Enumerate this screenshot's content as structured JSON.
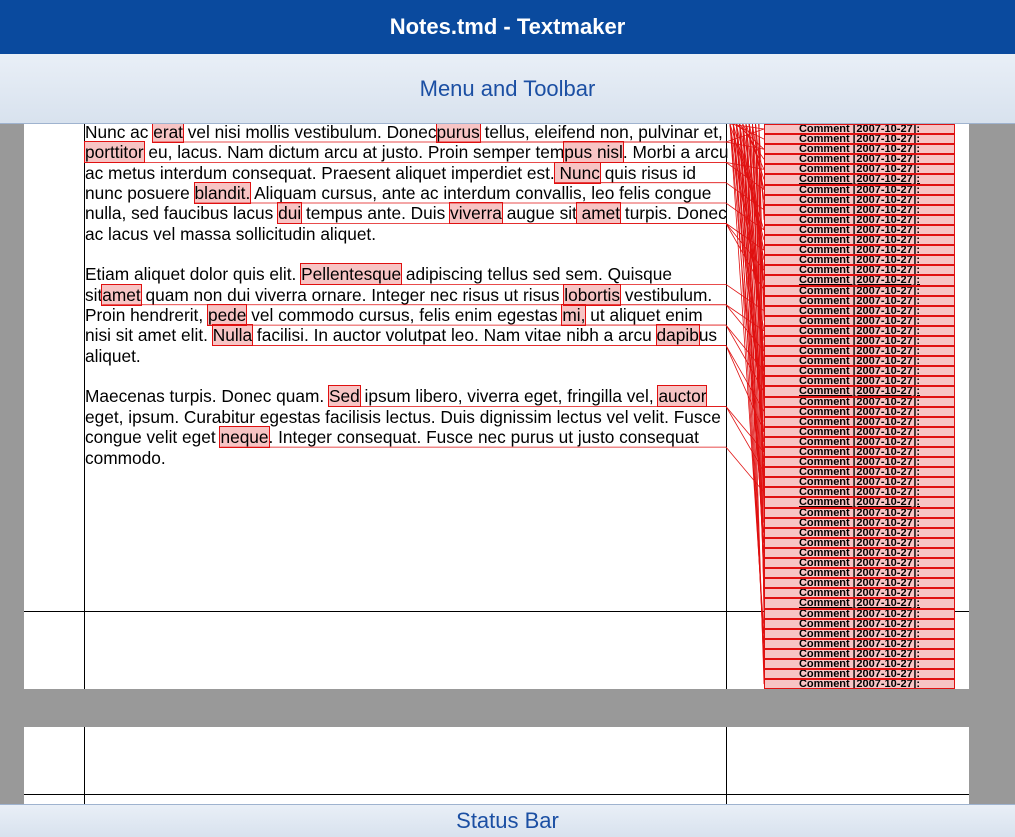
{
  "window": {
    "title": "Notes.tmd - Textmaker"
  },
  "toolbar": {
    "label": "Menu and Toolbar"
  },
  "statusbar": {
    "label": "Status Bar"
  },
  "document": {
    "paragraphs": [
      [
        {
          "t": "Nunc ac "
        },
        {
          "t": "erat",
          "c": 1
        },
        {
          "t": " vel nisi mollis vestibulum. Donec"
        },
        {
          "t": "purus",
          "c": 1
        },
        {
          "t": " tellus, eleifend non, pulvinar et, "
        },
        {
          "t": "porttitor",
          "c": 1
        },
        {
          "t": " eu, lacus. Nam dictum arcu at justo. Proin semper tem"
        },
        {
          "t": "pus nisl",
          "c": 1
        },
        {
          "t": ". Morbi a arcu ac metus interdum consequat. Praesent aliquet imperdiet est."
        },
        {
          "t": " Nunc",
          "c": 1
        },
        {
          "t": " quis risus id nunc posuere "
        },
        {
          "t": "blandit.",
          "c": 1
        },
        {
          "t": " Aliquam cursus, ante ac interdum convallis, leo felis congue nulla, sed faucibus lacus "
        },
        {
          "t": "dui",
          "c": 1
        },
        {
          "t": " tempus ante. Duis "
        },
        {
          "t": "viverra",
          "c": 1
        },
        {
          "t": " augue sit"
        },
        {
          "t": " amet",
          "c": 1
        },
        {
          "t": " turpis. Donec ac lacus vel massa sollicitudin aliquet."
        }
      ],
      [
        {
          "t": "Etiam aliquet dolor quis elit. "
        },
        {
          "t": "Pellentesque",
          "c": 1
        },
        {
          "t": " adipiscing tellus sed sem. Quisque sit"
        },
        {
          "t": "amet",
          "c": 1
        },
        {
          "t": " quam non dui viverra ornare. Integer nec risus ut risus "
        },
        {
          "t": "lobortis",
          "c": 1
        },
        {
          "t": " vestibulum. Proin hendrerit, "
        },
        {
          "t": "pede",
          "c": 1
        },
        {
          "t": " vel commodo cursus, felis enim egestas "
        },
        {
          "t": "mi,",
          "c": 1
        },
        {
          "t": " ut aliquet enim nisi sit amet elit. "
        },
        {
          "t": "Nulla",
          "c": 1
        },
        {
          "t": " facilisi. In auctor volutpat leo. Nam vitae nibh a arcu "
        },
        {
          "t": "dapib",
          "c": 1
        },
        {
          "t": "us aliquet."
        }
      ],
      [
        {
          "t": "Maecenas turpis. Donec quam. "
        },
        {
          "t": "Sed",
          "c": 1
        },
        {
          "t": " ipsum libero, viverra eget, fringilla vel, "
        },
        {
          "t": "auctor",
          "c": 1
        },
        {
          "t": " eget, ipsum. Curabitur egestas facilisis lectus. Duis dignissim lectus vel velit. Fusce congue velit eget "
        },
        {
          "t": "neque",
          "c": 1
        },
        {
          "t": ". Integer consequat. Fusce nec purus ut justo consequat commodo."
        }
      ]
    ]
  },
  "comments": {
    "label": "Comment [2007-10-27]:",
    "count": 56
  }
}
